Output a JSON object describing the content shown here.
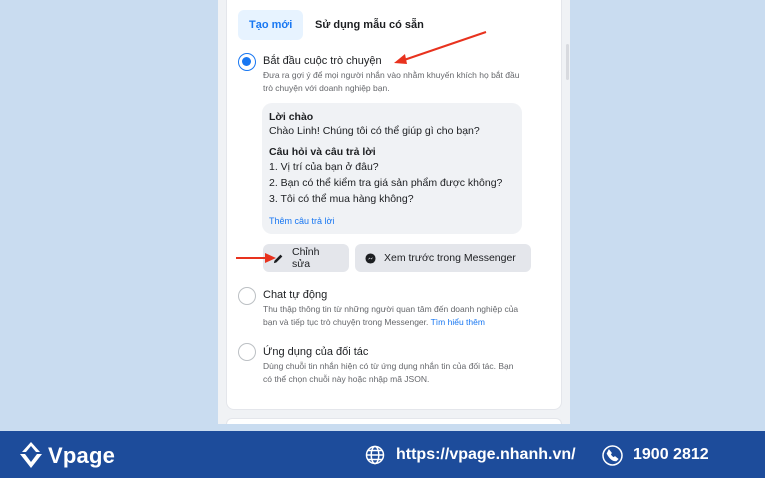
{
  "tabs": [
    {
      "label": "Tạo mới"
    },
    {
      "label": "Sử dụng mẫu có sẵn"
    }
  ],
  "options": {
    "conversation": {
      "title": "Bắt đầu cuộc trò chuyện",
      "desc_line1": "Đưa ra gợi ý để mọi người nhắn vào nhằm khuyến khích họ bắt đầu",
      "desc_line2": "trò chuyện với doanh nghiệp bạn."
    },
    "chat": {
      "title": "Chat tự động",
      "desc_line1": "Thu thập thông tin từ những người quan tâm đến doanh nghiệp của",
      "desc_line2": "bạn và tiếp tục trò chuyện trong Messenger.",
      "learn_more": "Tìm hiểu thêm"
    },
    "partner": {
      "title": "Ứng dụng của đối tác",
      "desc_line1": "Dùng chuỗi tin nhắn hiện có từ ứng dụng nhắn tin của đối tác. Bạn",
      "desc_line2": "có thể chọn chuỗi này hoặc nhập mã JSON."
    }
  },
  "preview": {
    "greeting_heading": "Lời chào",
    "greeting_text": "Chào Linh! Chúng tôi có thể giúp gì cho bạn?",
    "qa_heading": "Câu hỏi và câu trả lời",
    "questions": [
      "1. Vị trí của bạn ở đâu?",
      "2. Bạn có thể kiểm tra giá sản phẩm được không?",
      "3. Tôi có thể mua hàng không?"
    ],
    "add_answer": "Thêm câu trả lời"
  },
  "buttons": {
    "edit": "Chỉnh sửa",
    "preview_messenger": "Xem trước trong Messenger"
  },
  "footer": {
    "brand": "Vpage",
    "website": "https://vpage.nhanh.vn/",
    "phone": "1900 2812"
  },
  "colors": {
    "accent": "#1877f2",
    "footer_bg": "#1d4c9b",
    "annotation_arrow": "#e8321e"
  }
}
